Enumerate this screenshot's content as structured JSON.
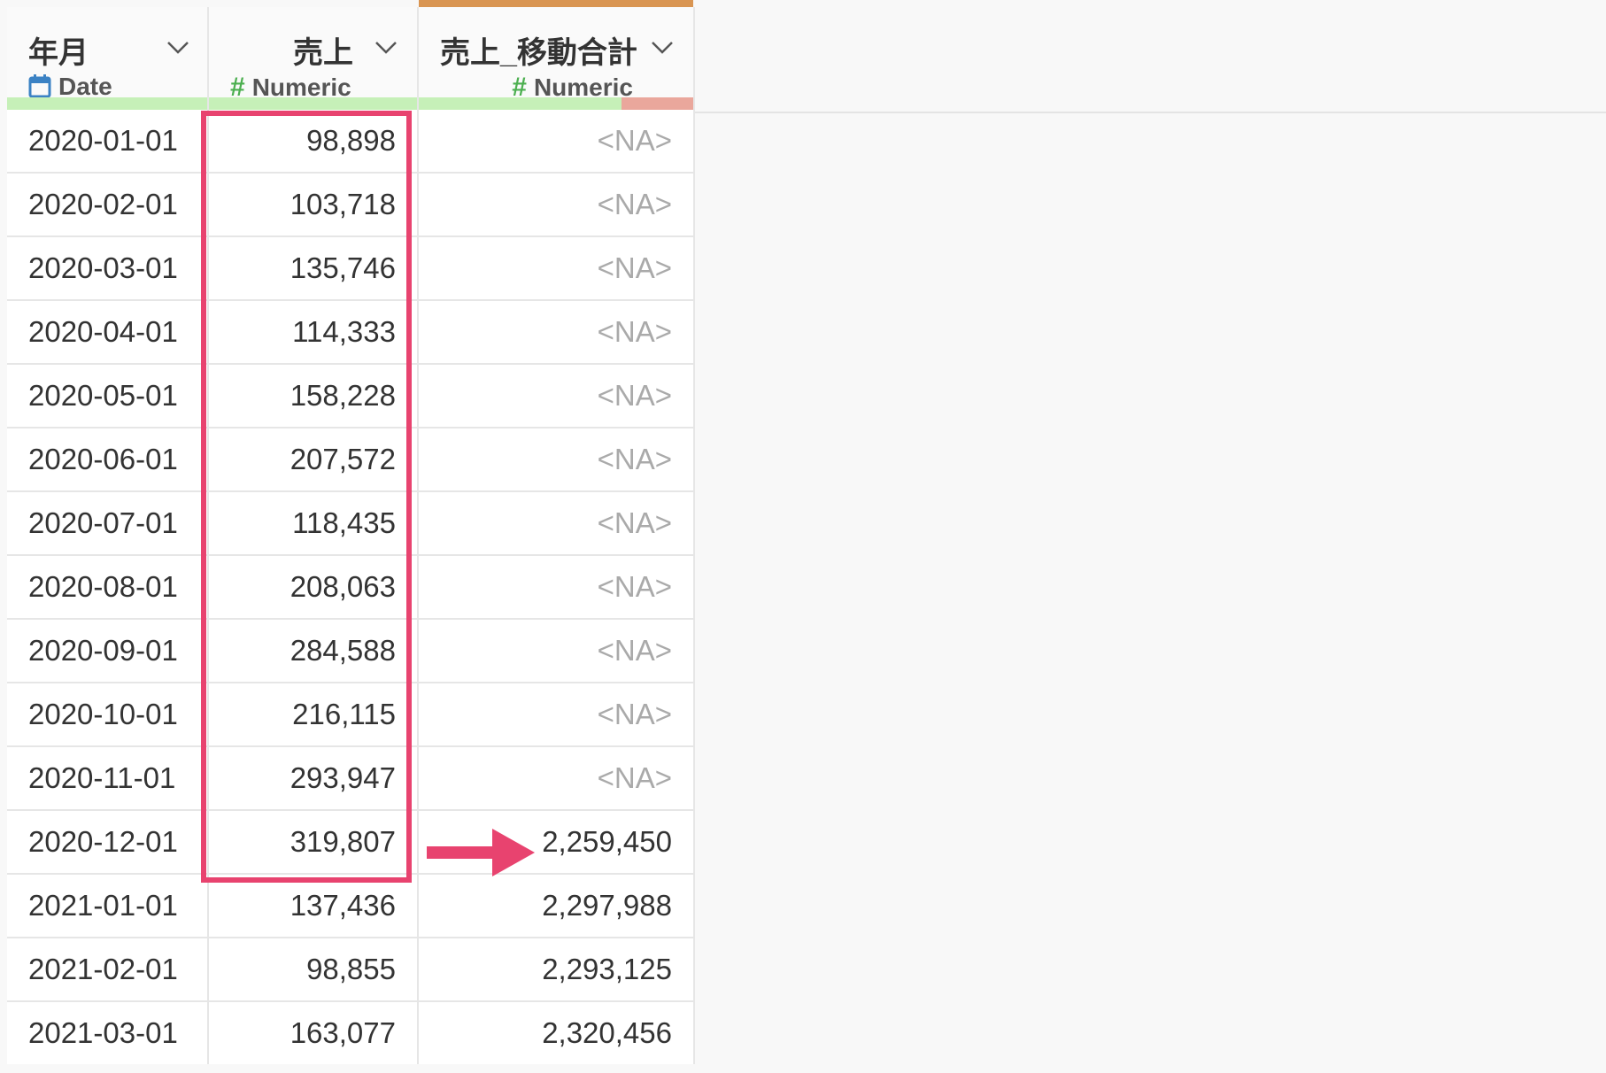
{
  "columns": [
    {
      "name": "年月",
      "type_label": "Date",
      "type_icon": "calendar-icon",
      "accent": "",
      "quality": [
        {
          "color": "#c6f0b8",
          "fraction": 1.0
        }
      ]
    },
    {
      "name": "売上",
      "type_label": "Numeric",
      "type_icon": "hash-icon",
      "accent": "",
      "quality": [
        {
          "color": "#c6f0b8",
          "fraction": 1.0
        }
      ]
    },
    {
      "name": "売上_移動合計",
      "type_label": "Numeric",
      "type_icon": "hash-icon",
      "accent": "#d99552",
      "quality": [
        {
          "color": "#c6f0b8",
          "fraction": 0.74
        },
        {
          "color": "#eaa79c",
          "fraction": 0.26
        }
      ]
    }
  ],
  "rows": [
    {
      "date": "2020-01-01",
      "sales": "98,898",
      "moving_total": "<NA>"
    },
    {
      "date": "2020-02-01",
      "sales": "103,718",
      "moving_total": "<NA>"
    },
    {
      "date": "2020-03-01",
      "sales": "135,746",
      "moving_total": "<NA>"
    },
    {
      "date": "2020-04-01",
      "sales": "114,333",
      "moving_total": "<NA>"
    },
    {
      "date": "2020-05-01",
      "sales": "158,228",
      "moving_total": "<NA>"
    },
    {
      "date": "2020-06-01",
      "sales": "207,572",
      "moving_total": "<NA>"
    },
    {
      "date": "2020-07-01",
      "sales": "118,435",
      "moving_total": "<NA>"
    },
    {
      "date": "2020-08-01",
      "sales": "208,063",
      "moving_total": "<NA>"
    },
    {
      "date": "2020-09-01",
      "sales": "284,588",
      "moving_total": "<NA>"
    },
    {
      "date": "2020-10-01",
      "sales": "216,115",
      "moving_total": "<NA>"
    },
    {
      "date": "2020-11-01",
      "sales": "293,947",
      "moving_total": "<NA>"
    },
    {
      "date": "2020-12-01",
      "sales": "319,807",
      "moving_total": "2,259,450"
    },
    {
      "date": "2021-01-01",
      "sales": "137,436",
      "moving_total": "2,297,988"
    },
    {
      "date": "2021-02-01",
      "sales": "98,855",
      "moving_total": "2,293,125"
    },
    {
      "date": "2021-03-01",
      "sales": "163,077",
      "moving_total": "2,320,456"
    }
  ],
  "annotation": {
    "highlight_color": "#e8436f",
    "arrow_color": "#e8436f",
    "highlight_rows": "2020-01-01 – 2020-12-01",
    "arrow_row": "2020-12-01"
  }
}
